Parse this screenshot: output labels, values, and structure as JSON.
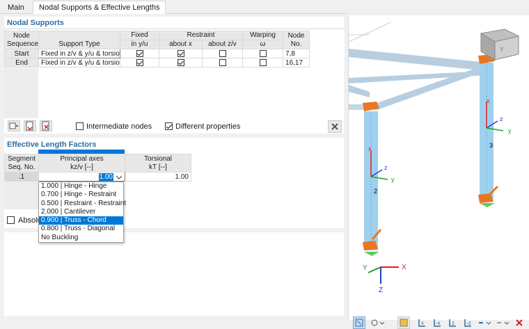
{
  "tabs": [
    {
      "label": "Main",
      "active": false
    },
    {
      "label": "Nodal Supports & Effective Lengths",
      "active": true
    }
  ],
  "nodal_supports": {
    "title": "Nodal Supports",
    "headers": {
      "node_sequence": [
        "Node",
        "Sequence"
      ],
      "support_type": "Support Type",
      "fixed": [
        "Fixed",
        "in y/u"
      ],
      "restraint": "Restraint",
      "about_x": "about x",
      "about_zv": "about z/v",
      "warping": [
        "Warping",
        "ω"
      ],
      "node_no": [
        "Node",
        "No."
      ]
    },
    "rows": [
      {
        "sequence": "Start",
        "support_type": "Fixed in z/v & y/u & torsion",
        "fixed_yu": true,
        "about_x": true,
        "about_zv": false,
        "warping": false,
        "node_no": "7,8"
      },
      {
        "sequence": "End",
        "support_type": "Fixed in z/v & y/u & torsion",
        "fixed_yu": true,
        "about_x": true,
        "about_zv": false,
        "warping": false,
        "node_no": "16,17"
      }
    ],
    "intermediate_nodes": {
      "label": "Intermediate nodes",
      "checked": false
    },
    "different_properties": {
      "label": "Different properties",
      "checked": true
    }
  },
  "effective_length": {
    "title": "Effective Length Factors",
    "headers": {
      "segment": [
        "Segment",
        "Seq. No."
      ],
      "principal": [
        "Principal axes",
        "kz/v [--]"
      ],
      "torsional": [
        "Torsional",
        "kT [--]"
      ]
    },
    "rows": [
      {
        "segment": ".1",
        "kzv": "1.00",
        "kt": "1.00"
      }
    ],
    "absolute_label": "Absolu",
    "dropdown_options": [
      "1.000 | Hinge - Hinge",
      "0.700 | Hinge - Restraint",
      "0.500 | Restraint - Restraint",
      "2.000 | Cantilever",
      "0.900 | Truss - Chord",
      "0.800 | Truss - Diagonal",
      "No Buckling"
    ],
    "dropdown_selected_index": 4
  },
  "view": {
    "member_labels": [
      "2",
      "3"
    ],
    "axis_labels": {
      "x": "x",
      "y": "y",
      "z": "z",
      "X": "X",
      "Y": "Y",
      "Z": "Z"
    },
    "colors": {
      "member": "#9fd0ee",
      "beam": "#b8cee0",
      "support": "#e87722",
      "hinge": "#5dc85d",
      "x_axis": "#e02020",
      "y_axis": "#1aa31a",
      "z_axis": "#2040d0",
      "selection": "#0078d7",
      "section_accent": "#2d6ca2"
    }
  }
}
